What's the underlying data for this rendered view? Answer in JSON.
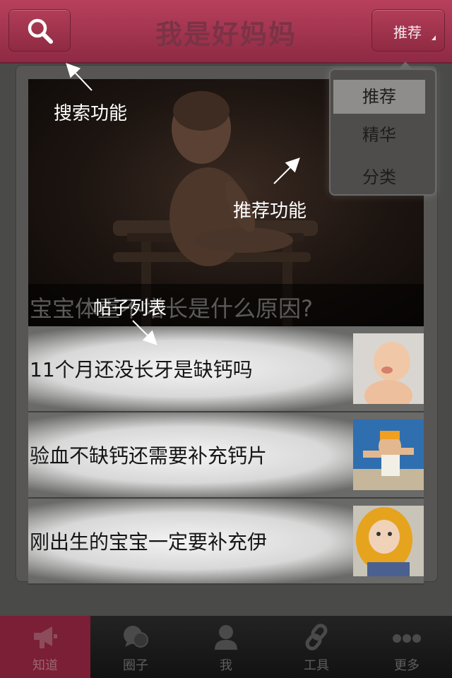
{
  "header": {
    "title": "我是好妈妈",
    "recommend_button_label": "推荐"
  },
  "dropdown": {
    "items": [
      "推荐",
      "精华",
      "分类"
    ],
    "active_index": 0
  },
  "hero": {
    "caption": "宝宝体重不增长是什么原因?"
  },
  "posts": [
    {
      "title": "11个月还没长牙是缺钙吗"
    },
    {
      "title": "验血不缺钙还需要补充钙片"
    },
    {
      "title": "刚出生的宝宝一定要补充伊"
    }
  ],
  "annotations": {
    "search": "搜索功能",
    "recommend": "推荐功能",
    "post_list": "帖子列表"
  },
  "tabs": [
    {
      "label": "知道",
      "icon": "megaphone-icon",
      "active": true
    },
    {
      "label": "圈子",
      "icon": "chat-bubbles-icon",
      "active": false
    },
    {
      "label": "我",
      "icon": "user-icon",
      "active": false
    },
    {
      "label": "工具",
      "icon": "link-icon",
      "active": false
    },
    {
      "label": "更多",
      "icon": "more-dots-icon",
      "active": false
    }
  ],
  "colors": {
    "header": "#a8364f",
    "active_tab": "#7a1f35"
  }
}
